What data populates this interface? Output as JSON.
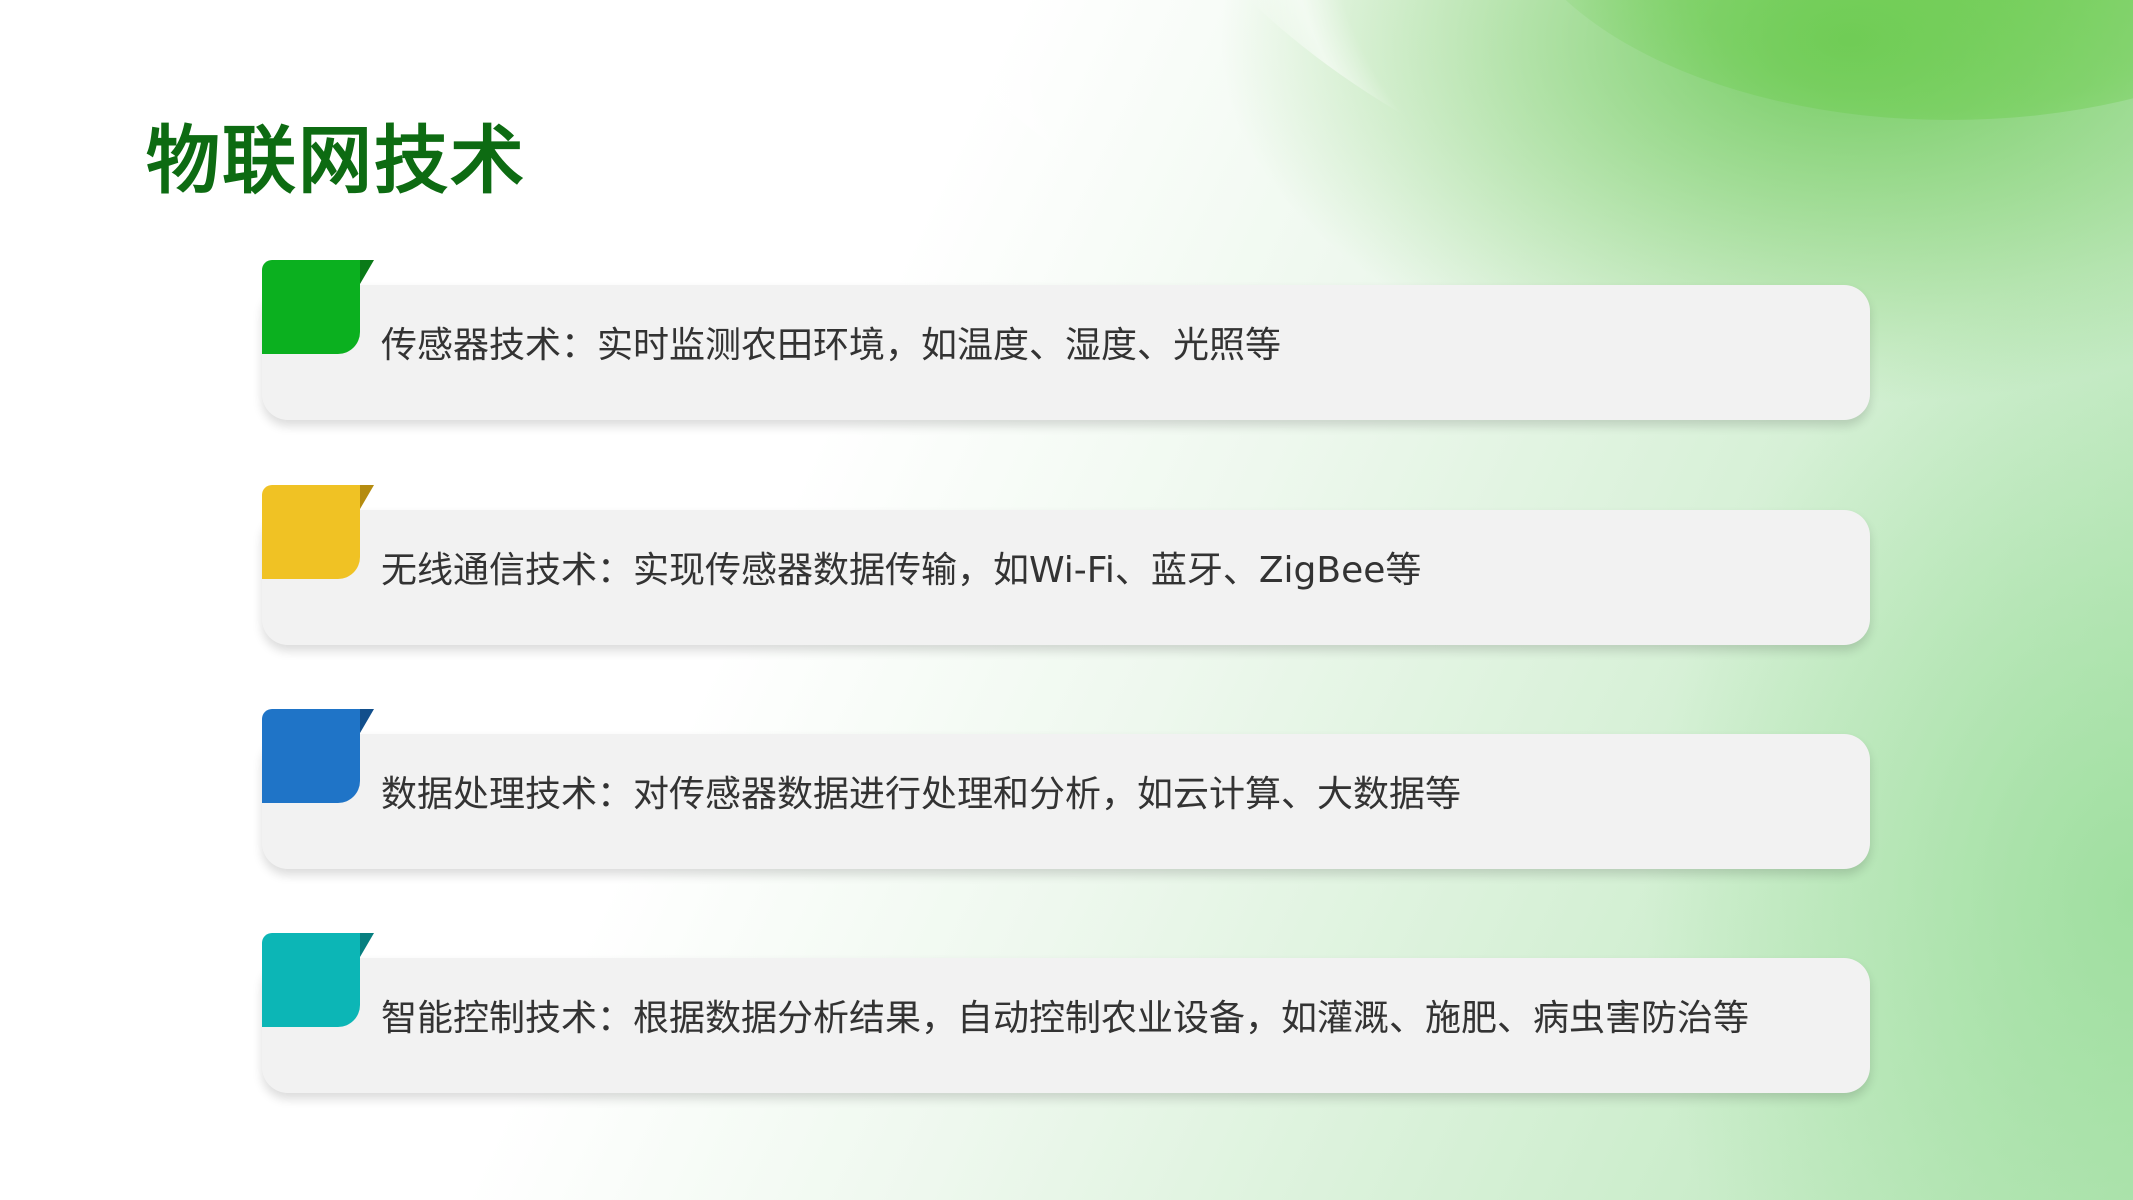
{
  "page": {
    "title": "物联网技术"
  },
  "items": [
    {
      "text": "传感器技术：实时监测农田环境，如温度、湿度、光照等",
      "color": "#0bb01f",
      "fold_color": "#0a7a18"
    },
    {
      "text": "无线通信技术：实现传感器数据传输，如Wi-Fi、蓝牙、ZigBee等",
      "color": "#f0c224",
      "fold_color": "#b58c10"
    },
    {
      "text": "数据处理技术：对传感器数据进行处理和分析，如云计算、大数据等",
      "color": "#1f74c7",
      "fold_color": "#124f8c"
    },
    {
      "text": "智能控制技术：根据数据分析结果，自动控制农业设备，如灌溉、施肥、病虫害防治等",
      "color": "#0cb6b6",
      "fold_color": "#077f80"
    }
  ]
}
